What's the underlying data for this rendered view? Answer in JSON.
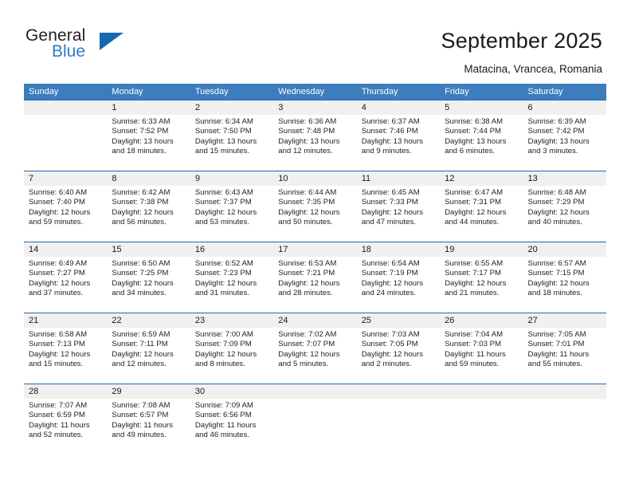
{
  "logo": {
    "word_one": "General",
    "word_two": "Blue",
    "triangle": "triangle-icon",
    "colors": {
      "general": "#231f20",
      "blue": "#2b7cc4",
      "triangle": "#1668b0"
    }
  },
  "header": {
    "title": "September 2025",
    "subtitle": "Matacina, Vrancea, Romania"
  },
  "colors": {
    "header_band": "#3b7dbd",
    "week_rule": "#1f6bb0",
    "day_band": "#f0f0f0",
    "text": "#232323"
  },
  "calendar": {
    "weekdays": [
      "Sunday",
      "Monday",
      "Tuesday",
      "Wednesday",
      "Thursday",
      "Friday",
      "Saturday"
    ],
    "weeks": [
      {
        "days": [
          {
            "number": "",
            "sunrise": "",
            "sunset": "",
            "daylight_line1": "",
            "daylight_line2": ""
          },
          {
            "number": "1",
            "sunrise": "Sunrise: 6:33 AM",
            "sunset": "Sunset: 7:52 PM",
            "daylight_line1": "Daylight: 13 hours",
            "daylight_line2": "and 18 minutes."
          },
          {
            "number": "2",
            "sunrise": "Sunrise: 6:34 AM",
            "sunset": "Sunset: 7:50 PM",
            "daylight_line1": "Daylight: 13 hours",
            "daylight_line2": "and 15 minutes."
          },
          {
            "number": "3",
            "sunrise": "Sunrise: 6:36 AM",
            "sunset": "Sunset: 7:48 PM",
            "daylight_line1": "Daylight: 13 hours",
            "daylight_line2": "and 12 minutes."
          },
          {
            "number": "4",
            "sunrise": "Sunrise: 6:37 AM",
            "sunset": "Sunset: 7:46 PM",
            "daylight_line1": "Daylight: 13 hours",
            "daylight_line2": "and 9 minutes."
          },
          {
            "number": "5",
            "sunrise": "Sunrise: 6:38 AM",
            "sunset": "Sunset: 7:44 PM",
            "daylight_line1": "Daylight: 13 hours",
            "daylight_line2": "and 6 minutes."
          },
          {
            "number": "6",
            "sunrise": "Sunrise: 6:39 AM",
            "sunset": "Sunset: 7:42 PM",
            "daylight_line1": "Daylight: 13 hours",
            "daylight_line2": "and 3 minutes."
          }
        ]
      },
      {
        "days": [
          {
            "number": "7",
            "sunrise": "Sunrise: 6:40 AM",
            "sunset": "Sunset: 7:40 PM",
            "daylight_line1": "Daylight: 12 hours",
            "daylight_line2": "and 59 minutes."
          },
          {
            "number": "8",
            "sunrise": "Sunrise: 6:42 AM",
            "sunset": "Sunset: 7:38 PM",
            "daylight_line1": "Daylight: 12 hours",
            "daylight_line2": "and 56 minutes."
          },
          {
            "number": "9",
            "sunrise": "Sunrise: 6:43 AM",
            "sunset": "Sunset: 7:37 PM",
            "daylight_line1": "Daylight: 12 hours",
            "daylight_line2": "and 53 minutes."
          },
          {
            "number": "10",
            "sunrise": "Sunrise: 6:44 AM",
            "sunset": "Sunset: 7:35 PM",
            "daylight_line1": "Daylight: 12 hours",
            "daylight_line2": "and 50 minutes."
          },
          {
            "number": "11",
            "sunrise": "Sunrise: 6:45 AM",
            "sunset": "Sunset: 7:33 PM",
            "daylight_line1": "Daylight: 12 hours",
            "daylight_line2": "and 47 minutes."
          },
          {
            "number": "12",
            "sunrise": "Sunrise: 6:47 AM",
            "sunset": "Sunset: 7:31 PM",
            "daylight_line1": "Daylight: 12 hours",
            "daylight_line2": "and 44 minutes."
          },
          {
            "number": "13",
            "sunrise": "Sunrise: 6:48 AM",
            "sunset": "Sunset: 7:29 PM",
            "daylight_line1": "Daylight: 12 hours",
            "daylight_line2": "and 40 minutes."
          }
        ]
      },
      {
        "days": [
          {
            "number": "14",
            "sunrise": "Sunrise: 6:49 AM",
            "sunset": "Sunset: 7:27 PM",
            "daylight_line1": "Daylight: 12 hours",
            "daylight_line2": "and 37 minutes."
          },
          {
            "number": "15",
            "sunrise": "Sunrise: 6:50 AM",
            "sunset": "Sunset: 7:25 PM",
            "daylight_line1": "Daylight: 12 hours",
            "daylight_line2": "and 34 minutes."
          },
          {
            "number": "16",
            "sunrise": "Sunrise: 6:52 AM",
            "sunset": "Sunset: 7:23 PM",
            "daylight_line1": "Daylight: 12 hours",
            "daylight_line2": "and 31 minutes."
          },
          {
            "number": "17",
            "sunrise": "Sunrise: 6:53 AM",
            "sunset": "Sunset: 7:21 PM",
            "daylight_line1": "Daylight: 12 hours",
            "daylight_line2": "and 28 minutes."
          },
          {
            "number": "18",
            "sunrise": "Sunrise: 6:54 AM",
            "sunset": "Sunset: 7:19 PM",
            "daylight_line1": "Daylight: 12 hours",
            "daylight_line2": "and 24 minutes."
          },
          {
            "number": "19",
            "sunrise": "Sunrise: 6:55 AM",
            "sunset": "Sunset: 7:17 PM",
            "daylight_line1": "Daylight: 12 hours",
            "daylight_line2": "and 21 minutes."
          },
          {
            "number": "20",
            "sunrise": "Sunrise: 6:57 AM",
            "sunset": "Sunset: 7:15 PM",
            "daylight_line1": "Daylight: 12 hours",
            "daylight_line2": "and 18 minutes."
          }
        ]
      },
      {
        "days": [
          {
            "number": "21",
            "sunrise": "Sunrise: 6:58 AM",
            "sunset": "Sunset: 7:13 PM",
            "daylight_line1": "Daylight: 12 hours",
            "daylight_line2": "and 15 minutes."
          },
          {
            "number": "22",
            "sunrise": "Sunrise: 6:59 AM",
            "sunset": "Sunset: 7:11 PM",
            "daylight_line1": "Daylight: 12 hours",
            "daylight_line2": "and 12 minutes."
          },
          {
            "number": "23",
            "sunrise": "Sunrise: 7:00 AM",
            "sunset": "Sunset: 7:09 PM",
            "daylight_line1": "Daylight: 12 hours",
            "daylight_line2": "and 8 minutes."
          },
          {
            "number": "24",
            "sunrise": "Sunrise: 7:02 AM",
            "sunset": "Sunset: 7:07 PM",
            "daylight_line1": "Daylight: 12 hours",
            "daylight_line2": "and 5 minutes."
          },
          {
            "number": "25",
            "sunrise": "Sunrise: 7:03 AM",
            "sunset": "Sunset: 7:05 PM",
            "daylight_line1": "Daylight: 12 hours",
            "daylight_line2": "and 2 minutes."
          },
          {
            "number": "26",
            "sunrise": "Sunrise: 7:04 AM",
            "sunset": "Sunset: 7:03 PM",
            "daylight_line1": "Daylight: 11 hours",
            "daylight_line2": "and 59 minutes."
          },
          {
            "number": "27",
            "sunrise": "Sunrise: 7:05 AM",
            "sunset": "Sunset: 7:01 PM",
            "daylight_line1": "Daylight: 11 hours",
            "daylight_line2": "and 55 minutes."
          }
        ]
      },
      {
        "days": [
          {
            "number": "28",
            "sunrise": "Sunrise: 7:07 AM",
            "sunset": "Sunset: 6:59 PM",
            "daylight_line1": "Daylight: 11 hours",
            "daylight_line2": "and 52 minutes."
          },
          {
            "number": "29",
            "sunrise": "Sunrise: 7:08 AM",
            "sunset": "Sunset: 6:57 PM",
            "daylight_line1": "Daylight: 11 hours",
            "daylight_line2": "and 49 minutes."
          },
          {
            "number": "30",
            "sunrise": "Sunrise: 7:09 AM",
            "sunset": "Sunset: 6:56 PM",
            "daylight_line1": "Daylight: 11 hours",
            "daylight_line2": "and 46 minutes."
          },
          {
            "number": "",
            "sunrise": "",
            "sunset": "",
            "daylight_line1": "",
            "daylight_line2": ""
          },
          {
            "number": "",
            "sunrise": "",
            "sunset": "",
            "daylight_line1": "",
            "daylight_line2": ""
          },
          {
            "number": "",
            "sunrise": "",
            "sunset": "",
            "daylight_line1": "",
            "daylight_line2": ""
          },
          {
            "number": "",
            "sunrise": "",
            "sunset": "",
            "daylight_line1": "",
            "daylight_line2": ""
          }
        ]
      }
    ]
  }
}
